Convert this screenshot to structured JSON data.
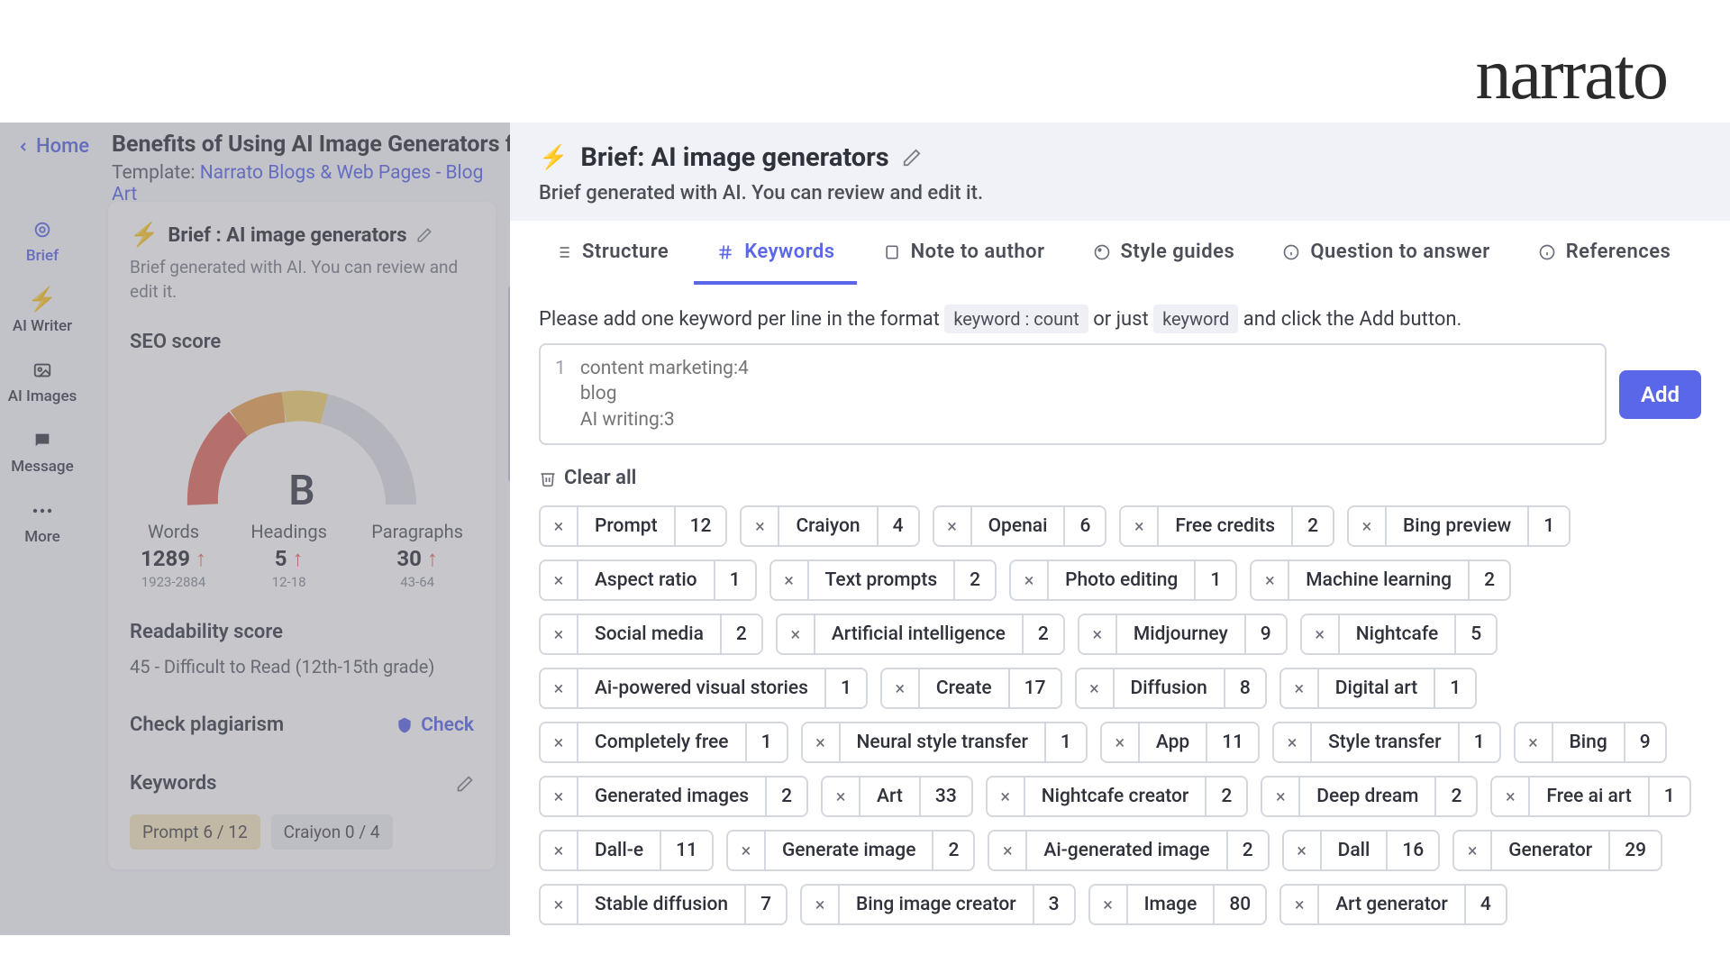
{
  "brand": "narrato",
  "nav": {
    "home": "Home"
  },
  "doc": {
    "title": "Benefits of Using AI Image Generators for",
    "template_prefix": "Template: ",
    "template_link": "Narrato Blogs & Web Pages - Blog Art"
  },
  "side_nav": [
    {
      "label": "Brief"
    },
    {
      "label": "AI Writer"
    },
    {
      "label": "AI Images"
    },
    {
      "label": "Message"
    },
    {
      "label": "More"
    }
  ],
  "brief_card": {
    "title": "Brief : AI image generators",
    "sub": "Brief generated with AI. You can review and edit it."
  },
  "seo": {
    "heading": "SEO score",
    "grade": "B",
    "metrics": [
      {
        "label": "Words",
        "value": "1289",
        "range": "1923-2884"
      },
      {
        "label": "Headings",
        "value": "5",
        "range": "12-18"
      },
      {
        "label": "Paragraphs",
        "value": "30",
        "range": "43-64"
      }
    ]
  },
  "readability": {
    "heading": "Readability score",
    "text": "45 - Difficult to Read (12th-15th grade)"
  },
  "plagiarism": {
    "label": "Check plagiarism",
    "action": "Check"
  },
  "left_keywords": {
    "label": "Keywords",
    "chips": [
      {
        "text": "Prompt  6 / 12",
        "alt": false
      },
      {
        "text": "Craiyon  0 / 4",
        "alt": true
      }
    ]
  },
  "panel": {
    "title": "Brief: AI image generators",
    "sub": "Brief generated with AI. You can review and edit it."
  },
  "tabs": [
    {
      "label": "Structure"
    },
    {
      "label": "Keywords"
    },
    {
      "label": "Note to author"
    },
    {
      "label": "Style guides"
    },
    {
      "label": "Question to answer"
    },
    {
      "label": "References"
    }
  ],
  "instr": {
    "pre": "Please add one keyword per line in the format ",
    "code1": "keyword : count",
    "mid": " or just ",
    "code2": "keyword",
    "post": " and click the Add button."
  },
  "input": {
    "line": "1",
    "placeholder": "content marketing:4\nblog\nAI writing:3"
  },
  "add_label": "Add",
  "clear_label": "Clear all",
  "tags": [
    {
      "t": "Prompt",
      "c": "12"
    },
    {
      "t": "Craiyon",
      "c": "4"
    },
    {
      "t": "Openai",
      "c": "6"
    },
    {
      "t": "Free credits",
      "c": "2"
    },
    {
      "t": "Bing preview",
      "c": "1"
    },
    {
      "t": "Aspect ratio",
      "c": "1"
    },
    {
      "t": "Text prompts",
      "c": "2"
    },
    {
      "t": "Photo editing",
      "c": "1"
    },
    {
      "t": "Machine learning",
      "c": "2"
    },
    {
      "t": "Social media",
      "c": "2"
    },
    {
      "t": "Artificial intelligence",
      "c": "2"
    },
    {
      "t": "Midjourney",
      "c": "9"
    },
    {
      "t": "Nightcafe",
      "c": "5"
    },
    {
      "t": "Ai-powered visual stories",
      "c": "1"
    },
    {
      "t": "Create",
      "c": "17"
    },
    {
      "t": "Diffusion",
      "c": "8"
    },
    {
      "t": "Digital art",
      "c": "1"
    },
    {
      "t": "Completely free",
      "c": "1"
    },
    {
      "t": "Neural style transfer",
      "c": "1"
    },
    {
      "t": "App",
      "c": "11"
    },
    {
      "t": "Style transfer",
      "c": "1"
    },
    {
      "t": "Bing",
      "c": "9"
    },
    {
      "t": "Generated images",
      "c": "2"
    },
    {
      "t": "Art",
      "c": "33"
    },
    {
      "t": "Nightcafe creator",
      "c": "2"
    },
    {
      "t": "Deep dream",
      "c": "2"
    },
    {
      "t": "Free ai art",
      "c": "1"
    },
    {
      "t": "Dall-e",
      "c": "11"
    },
    {
      "t": "Generate image",
      "c": "2"
    },
    {
      "t": "Ai-generated image",
      "c": "2"
    },
    {
      "t": "Dall",
      "c": "16"
    },
    {
      "t": "Generator",
      "c": "29"
    },
    {
      "t": "Stable diffusion",
      "c": "7"
    },
    {
      "t": "Bing image creator",
      "c": "3"
    },
    {
      "t": "Image",
      "c": "80"
    },
    {
      "t": "Art generator",
      "c": "4"
    }
  ]
}
